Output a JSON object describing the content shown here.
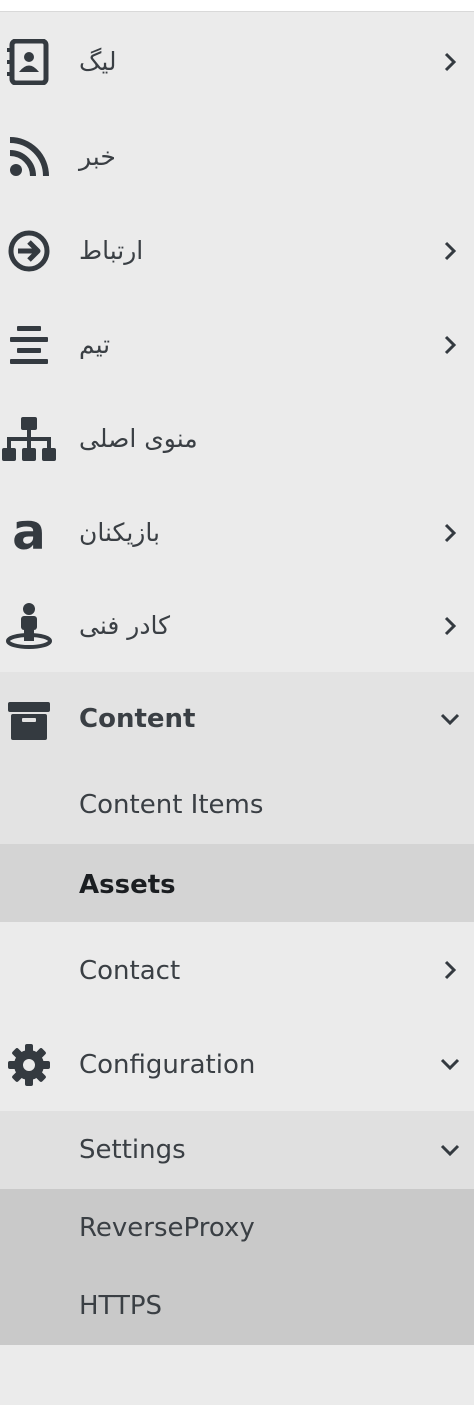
{
  "menu": {
    "items": [
      {
        "label": "لیگ",
        "icon": "contact-book-icon",
        "has_chevron": true
      },
      {
        "label": "خبر",
        "icon": "rss-icon",
        "has_chevron": false
      },
      {
        "label": "ارتباط",
        "icon": "arrow-circle-right-icon",
        "has_chevron": true
      },
      {
        "label": "تیم",
        "icon": "align-center-icon",
        "has_chevron": true
      },
      {
        "label": "منوی اصلی",
        "icon": "sitemap-icon",
        "has_chevron": false
      },
      {
        "label": "بازیکنان",
        "icon": "letter-a-icon",
        "has_chevron": true
      },
      {
        "label": "کادر فنی",
        "icon": "street-view-icon",
        "has_chevron": true
      }
    ],
    "content": {
      "label": "Content",
      "icon": "archive-icon",
      "children": [
        {
          "label": "Content Items"
        },
        {
          "label": "Assets",
          "selected": true
        }
      ]
    },
    "contact": {
      "label": "Contact"
    },
    "configuration": {
      "label": "Configuration",
      "icon": "gear-icon",
      "settings": {
        "label": "Settings",
        "children": [
          {
            "label": "ReverseProxy"
          },
          {
            "label": "HTTPS"
          }
        ]
      }
    }
  },
  "colors": {
    "background": "#ebebeb",
    "expanded_section": "#e3e3e3",
    "selected_item": "#d4d4d4",
    "nested_children": "#c9c9c9",
    "icon": "#343a40"
  }
}
